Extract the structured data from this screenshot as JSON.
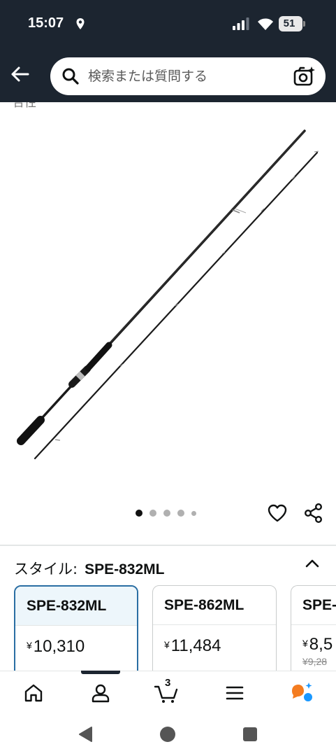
{
  "status_bar": {
    "time": "15:07",
    "battery": "51",
    "icons": [
      "location-icon",
      "signal-icon",
      "wifi-icon",
      "battery-icon"
    ]
  },
  "header": {
    "search_placeholder": "検索または質問する",
    "icons": [
      "back-arrow-icon",
      "search-icon",
      "camera-search-icon"
    ]
  },
  "partial_text": "合性",
  "carousel": {
    "total_dots": 5,
    "active_index": 0
  },
  "style_selector": {
    "label": "スタイル:",
    "selected_value": "SPE-832ML",
    "variants": [
      {
        "name": "SPE-832ML",
        "price": "10,310",
        "currency": "¥",
        "selected": true
      },
      {
        "name": "SPE-862ML",
        "price": "11,484",
        "currency": "¥",
        "selected": false
      },
      {
        "name": "SPE-",
        "price": "8,5",
        "currency": "¥",
        "was_price": "¥9,28",
        "selected": false
      }
    ]
  },
  "bottom_nav": {
    "items": [
      "home-icon",
      "account-icon",
      "cart-icon",
      "menu-icon",
      "rufus-ai-icon"
    ],
    "cart_count": "3"
  },
  "colors": {
    "header_bg": "#1c2530",
    "selected_border": "#2a6ea3",
    "selected_bg": "#edf6fb",
    "ai_orange": "#f47c20",
    "ai_blue": "#1a98ff"
  }
}
